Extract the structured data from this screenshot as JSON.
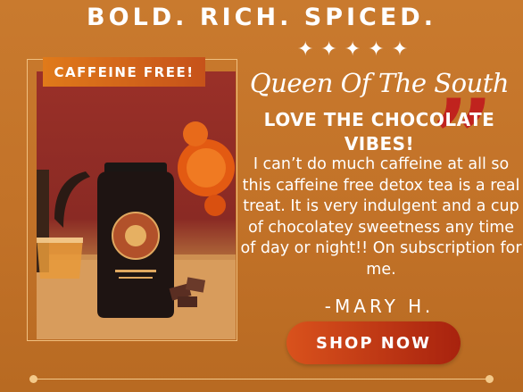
{
  "headline": "BOLD. RICH. SPICED.",
  "badge": "CAFFEINE FREE!",
  "stars": "✦✦✦✦✦",
  "product_name": "Queen Of The South",
  "review": {
    "title": "LOVE THE CHOCOLATE VIBES!",
    "body": "I can’t do much caffeine at all so this caffeine free detox tea is a real treat. It is very indulgent and a cup of chocolatey sweetness any time of day or night!! On subscription for me.",
    "author": "-MARY H."
  },
  "cta": {
    "label": "SHOP NOW"
  },
  "colors": {
    "background": "#c27228",
    "accent": "#c0231e",
    "badge": "#e07a1a"
  },
  "icons": {
    "quote": "quote-icon",
    "star": "star-icon"
  }
}
